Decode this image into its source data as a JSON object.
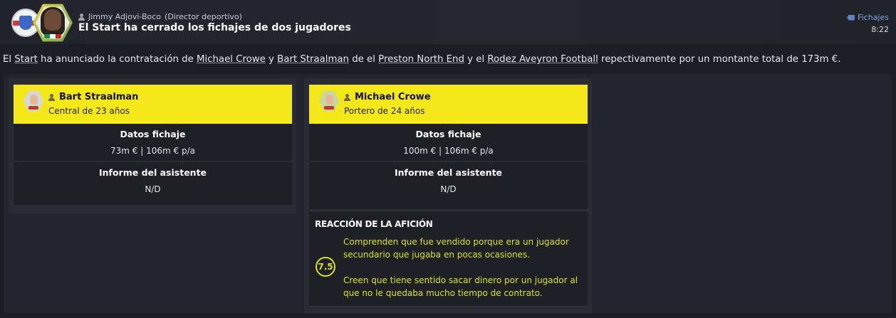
{
  "header": {
    "sender_name": "Jimmy Adjovi-Boco",
    "sender_role": "(Director deportivo)",
    "title": "El Start ha cerrado los fichajes de dos jugadores",
    "category": "Fichajes",
    "time": "8:22"
  },
  "body": {
    "t1": "El ",
    "club": "Start",
    "t2": " ha anunciado la contratación de ",
    "player1": "Michael Crowe",
    "t3": " y ",
    "player2": "Bart Straalman",
    "t4": " de el ",
    "club_from1": "Preston North End",
    "t5": " y el ",
    "club_from2": "Rodez Aveyron Football",
    "t6": " repectivamente por un montante total de 173m €."
  },
  "cards": [
    {
      "name": "Bart Straalman",
      "desc": "Central de 23 años",
      "transfer_label": "Datos fichaje",
      "transfer_value": "73m € | 106m € p/a",
      "report_label": "Informe del asistente",
      "report_value": "N/D"
    },
    {
      "name": "Michael Crowe",
      "desc": "Portero de 24 años",
      "transfer_label": "Datos fichaje",
      "transfer_value": "100m € | 106m € p/a",
      "report_label": "Informe del asistente",
      "report_value": "N/D",
      "fan_reaction": {
        "title": "REACCIÓN DE LA AFICIÓN",
        "score": "7.5",
        "comment1": "Comprenden que fue vendido porque era un jugador secundario que jugaba en pocas ocasiones.",
        "comment2": "Creen que tiene sentido sacar dinero por un jugador al que no le quedaba mucho tiempo de contrato."
      }
    }
  ],
  "colors": {
    "highlight": "#f5e81a",
    "fan_text": "#d9e21d",
    "link": "#7aa6e6"
  },
  "icons": [
    "club-badge-icon",
    "person-icon",
    "tag-icon"
  ]
}
